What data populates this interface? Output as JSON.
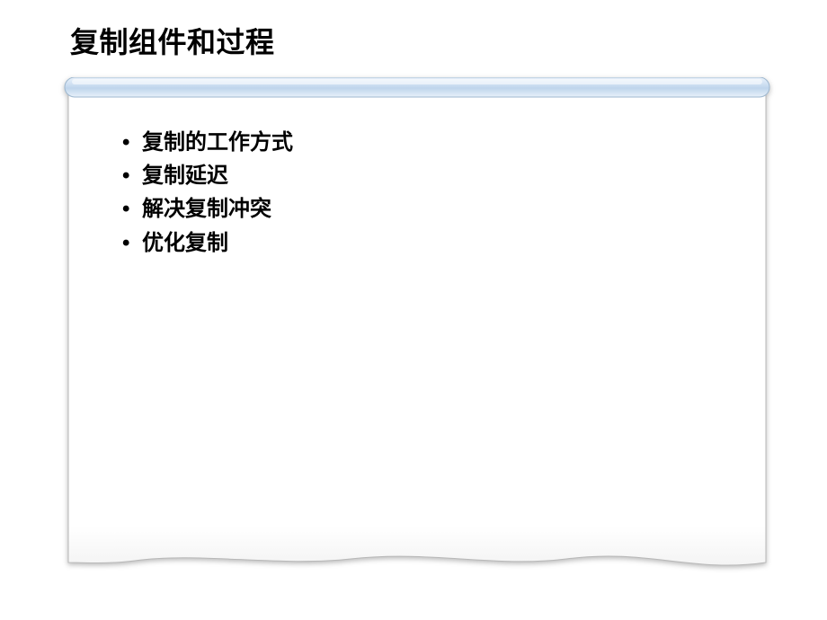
{
  "slide": {
    "title": "复制组件和过程",
    "bullets": [
      "复制的工作方式",
      "复制延迟",
      "解决复制冲突",
      "优化复制"
    ]
  }
}
